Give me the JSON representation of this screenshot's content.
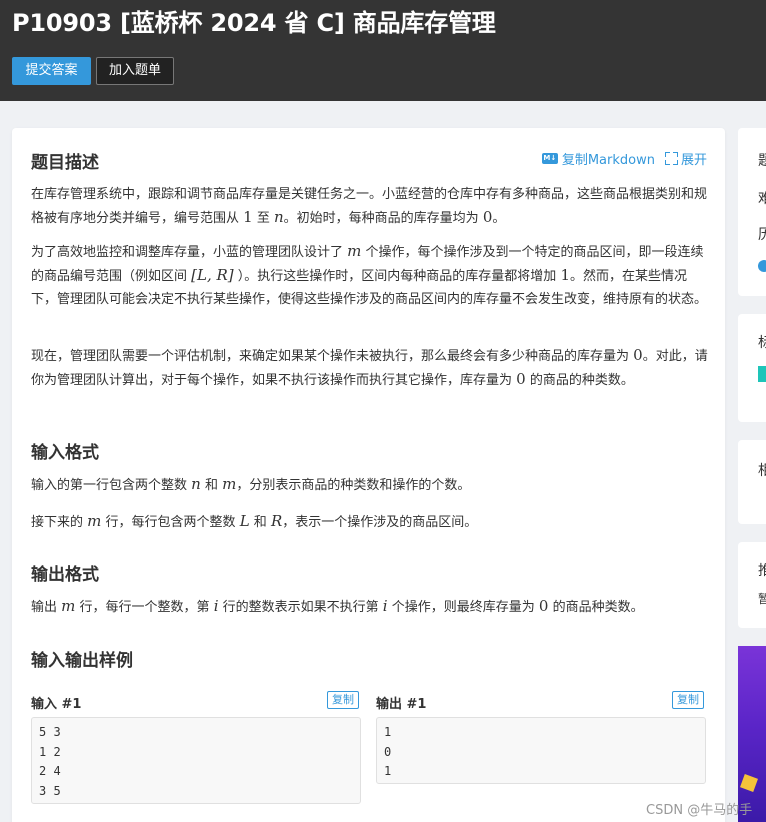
{
  "header": {
    "title": "P10903 [蓝桥杯 2024 省 C] 商品库存管理",
    "submit_button": "提交答案",
    "add_list_button": "加入题单"
  },
  "problem": {
    "description_heading": "题目描述",
    "copy_markdown_label": "复制Markdown",
    "expand_label": "展开",
    "md_badge": "M↓",
    "p1_a": "在库存管理系统中，跟踪和调节商品库存量是关键任务之一。小蓝经营的仓库中存有多种商品，这些商品根据类别和规格被有序地分类并编号，编号范围从",
    "p1_one": "1",
    "p1_b": "至",
    "p1_n": "n",
    "p1_c": "。初始时，每种商品的库存量均为",
    "p1_zero": "0",
    "p1_d": "。",
    "p2_a": "为了高效地监控和调整库存量，小蓝的管理团队设计了",
    "p2_m": "m",
    "p2_b": "个操作，每个操作涉及到一个特定的商品区间，即一段连续的商品编号范围（例如区间",
    "p2_interval": "[L, R]",
    "p2_c": "）。执行这些操作时，区间内每种商品的库存量都将增加",
    "p2_one": "1",
    "p2_d": "。然而，在某些情况下，管理团队可能会决定不执行某些操作，使得这些操作涉及的商品区间内的库存量不会发生改变，维持原有的状态。",
    "p3_a": "现在，管理团队需要一个评估机制，来确定如果某个操作未被执行，那么最终会有多少种商品的库存量为",
    "p3_zero": "0",
    "p3_b": "。对此，请你为管理团队计算出，对于每个操作，如果不执行该操作而执行其它操作，库存量为",
    "p3_zero2": "0",
    "p3_c": "的商品的种类数。",
    "input_heading": "输入格式",
    "in1_a": "输入的第一行包含两个整数",
    "in1_n": "n",
    "in1_b": "和",
    "in1_m": "m",
    "in1_c": "，分别表示商品的种类数和操作的个数。",
    "in2_a": "接下来的",
    "in2_m": "m",
    "in2_b": "行，每行包含两个整数",
    "in2_L": "L",
    "in2_c": "和",
    "in2_R": "R",
    "in2_d": "，表示一个操作涉及的商品区间。",
    "output_heading": "输出格式",
    "out_a": "输出",
    "out_m": "m",
    "out_b": "行，每行一个整数，第",
    "out_i": "i",
    "out_c": "行的整数表示如果不执行第",
    "out_i2": "i",
    "out_d": "个操作，则最终库存量为",
    "out_zero": "0",
    "out_e": "的商品种类数。",
    "samples_heading": "输入输出样例",
    "input_label": "输入 #1",
    "output_label": "输出 #1",
    "copy_label": "复制",
    "input_sample": "5 3\n1 2\n2 4\n3 5",
    "output_sample": "1\n0\n1"
  },
  "sidebar": {
    "card1_lines": [
      "题",
      "难",
      "历"
    ],
    "card2_line": "标",
    "card3_line": "相",
    "card4_line": "推",
    "card4_sub": "暂"
  },
  "watermark": "CSDN @牛马的手"
}
